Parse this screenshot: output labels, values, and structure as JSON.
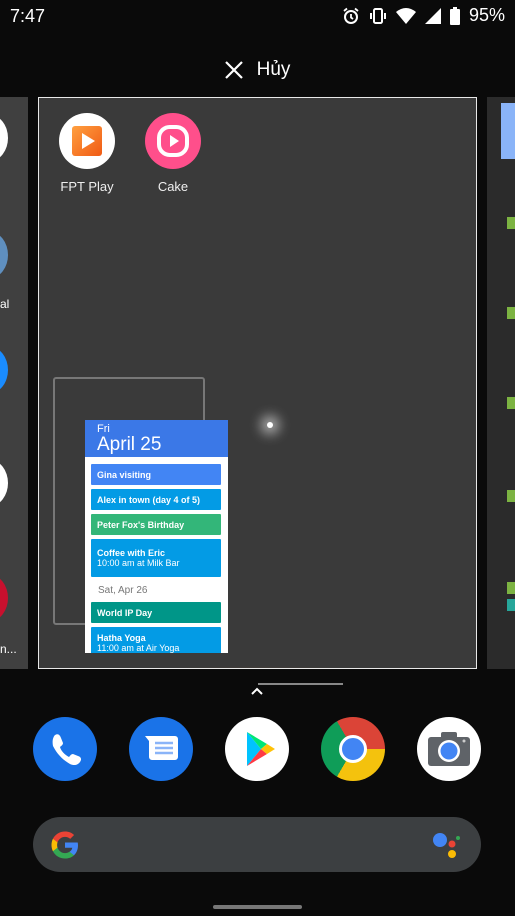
{
  "status_bar": {
    "time": "7:47",
    "battery": "95%",
    "icons": [
      "alarm-icon",
      "vibrate-icon",
      "wifi-icon",
      "signal-icon",
      "battery-icon"
    ]
  },
  "overview": {
    "cancel_label": "Hủy"
  },
  "main_pane": {
    "apps": [
      {
        "label": "FPT Play",
        "icon": "fpt-play-icon",
        "color": "#f26b1d"
      },
      {
        "label": "Cake",
        "icon": "cake-icon",
        "color": "#ff4f8b"
      }
    ],
    "calendar_widget": {
      "day": "Fri",
      "date": "April 25",
      "events": [
        {
          "title": "Gina visiting",
          "color": "#4285f4"
        },
        {
          "title": "Alex in town (day 4 of 5)",
          "color": "#039be5"
        },
        {
          "title": "Peter Fox's Birthday",
          "color": "#33b679"
        },
        {
          "title": "Coffee with Eric",
          "detail": "10:00 am at Milk Bar",
          "color": "#039be5"
        }
      ],
      "next_day": "Sat, Apr 26",
      "next_events": [
        {
          "title": "World IP Day",
          "color": "#009688"
        },
        {
          "title": "Hatha Yoga",
          "detail": "11:00 am at Air Yoga",
          "color": "#039be5"
        }
      ]
    }
  },
  "left_pane": {
    "labels": [
      "al",
      "n..."
    ]
  },
  "dock": [
    {
      "icon": "phone-icon"
    },
    {
      "icon": "messages-icon"
    },
    {
      "icon": "play-store-icon"
    },
    {
      "icon": "chrome-icon"
    },
    {
      "icon": "camera-icon"
    }
  ]
}
